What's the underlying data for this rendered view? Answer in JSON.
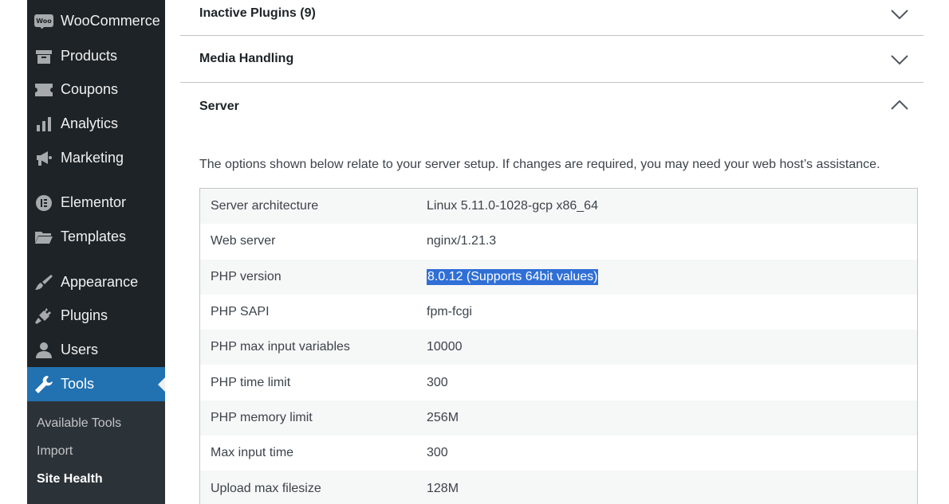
{
  "sidebar": {
    "items": [
      {
        "label": "WooCommerce",
        "icon": "woo-icon"
      },
      {
        "label": "Products",
        "icon": "archive-icon"
      },
      {
        "label": "Coupons",
        "icon": "ticket-icon"
      },
      {
        "label": "Analytics",
        "icon": "bar-chart-icon"
      },
      {
        "label": "Marketing",
        "icon": "megaphone-icon"
      },
      {
        "label": "Elementor",
        "icon": "elementor-icon"
      },
      {
        "label": "Templates",
        "icon": "folder-icon"
      },
      {
        "label": "Appearance",
        "icon": "paintbrush-icon"
      },
      {
        "label": "Plugins",
        "icon": "plug-icon"
      },
      {
        "label": "Users",
        "icon": "user-icon"
      },
      {
        "label": "Tools",
        "icon": "wrench-icon"
      }
    ],
    "submenu": [
      "Available Tools",
      "Import",
      "Site Health"
    ],
    "active_color": "#2271b1"
  },
  "accordions": {
    "inactive_plugins": "Inactive Plugins (9)",
    "media_handling": "Media Handling",
    "server": "Server"
  },
  "server": {
    "description": "The options shown below relate to your server setup. If changes are required, you may need your web host’s assistance.",
    "rows": [
      {
        "key": "Server architecture",
        "value": "Linux 5.11.0-1028-gcp x86_64"
      },
      {
        "key": "Web server",
        "value": "nginx/1.21.3"
      },
      {
        "key": "PHP version",
        "value": "8.0.12 (Supports 64bit values)"
      },
      {
        "key": "PHP SAPI",
        "value": "fpm-fcgi"
      },
      {
        "key": "PHP max input variables",
        "value": "10000"
      },
      {
        "key": "PHP time limit",
        "value": "300"
      },
      {
        "key": "PHP memory limit",
        "value": "256M"
      },
      {
        "key": "Max input time",
        "value": "300"
      },
      {
        "key": "Upload max filesize",
        "value": "128M"
      }
    ]
  }
}
